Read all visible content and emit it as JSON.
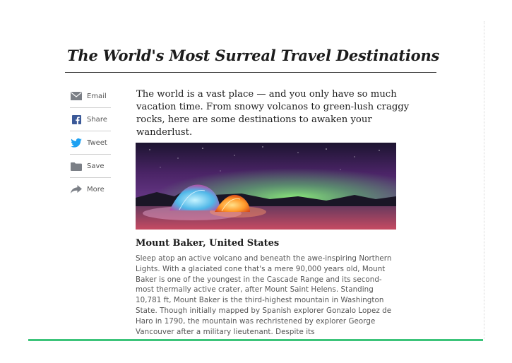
{
  "article": {
    "title": "The World's Most Surreal Travel Destinations",
    "intro": "The world is a vast place — and you only have so much vacation time. From snowy volcanos to green-lush craggy rocks, here are some destinations to awaken your wanderlust.",
    "section": {
      "heading": "Mount Baker, United States",
      "body": "Sleep atop an active volcano and beneath the awe-inspiring Northern Lights. With a glaciated cone that's a mere 90,000 years old, Mount Baker is one of the youngest in the Cascade Range and its second-most thermally active crater, after Mount Saint Helens. Standing 10,781 ft, Mount Baker is the third-highest mountain in Washington State. Though initially mapped by Spanish explorer Gonzalo Lopez de Haro in 1790, the mountain was rechristened by explorer George Vancouver after a military lieutenant. Despite its"
    }
  },
  "share": {
    "items": [
      {
        "label": "Email",
        "icon": "envelope-icon"
      },
      {
        "label": "Share",
        "icon": "facebook-icon"
      },
      {
        "label": "Tweet",
        "icon": "twitter-icon"
      },
      {
        "label": "Save",
        "icon": "folder-icon"
      },
      {
        "label": "More",
        "icon": "share-arrow-icon"
      }
    ]
  },
  "colors": {
    "accent_bar": "#3cc47a",
    "facebook": "#3b5998",
    "twitter": "#1da1f2"
  }
}
